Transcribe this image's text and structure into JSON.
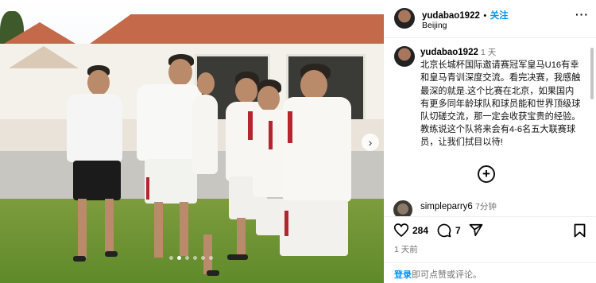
{
  "post": {
    "photo": {
      "carousel_dots": 6,
      "active_dot": 1
    },
    "author": {
      "username": "yudabao1922",
      "follow_label": "关注",
      "separator": "•",
      "location": "Beijing"
    },
    "caption": {
      "username": "yudabao1922",
      "time": "1 天",
      "text": "北京长城杯国际邀请赛冠军皇马U16有幸和皇马青训深度交流。看完决赛，我感触最深的就是.这个比赛在北京，如果国内有更多同年龄球队和球员能和世界顶级球队切磋交流，那一定会收获宝贵的经验。教练说这个队将来会有4-6名五大联赛球员，让我们拭目以待!"
    },
    "comment": {
      "username": "simpleparry6",
      "time": "7分钟"
    },
    "stats": {
      "likes": "284",
      "comments": "7"
    },
    "posted_ago": "1 天前",
    "login_prompt": {
      "link": "登录",
      "rest": "即可点赞或评论。"
    }
  }
}
